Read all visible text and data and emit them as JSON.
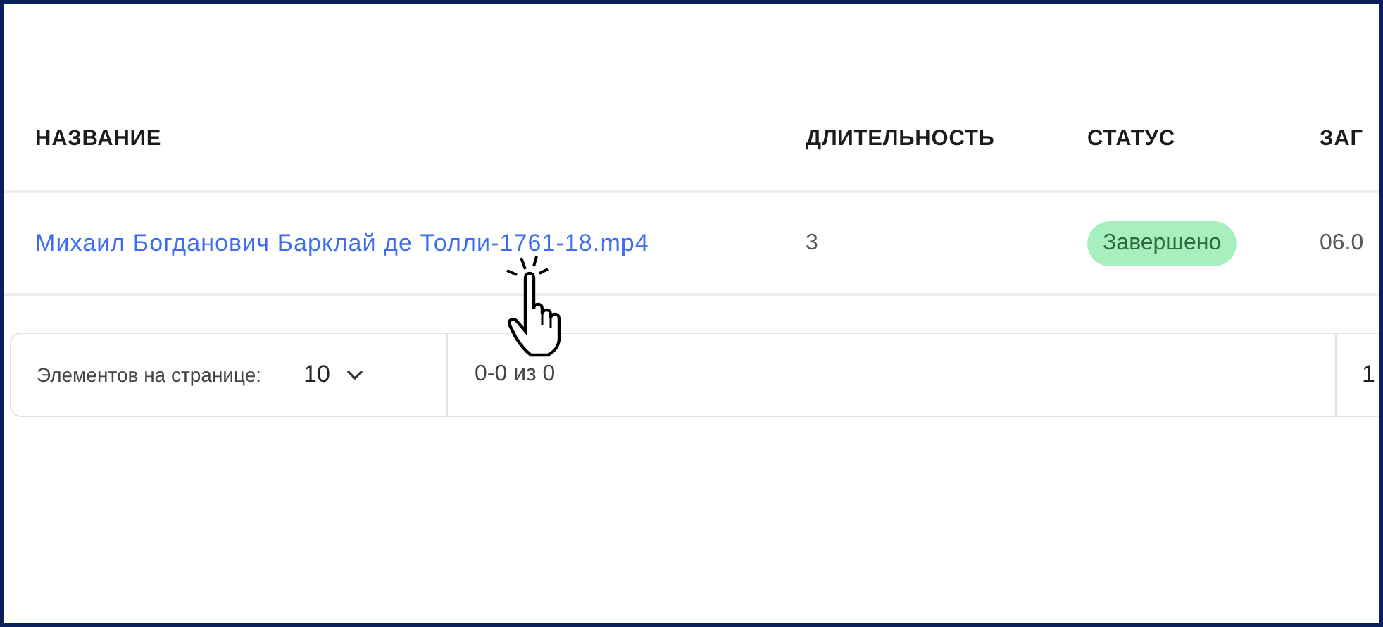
{
  "table": {
    "columns": [
      "НАЗВАНИЕ",
      "ДЛИТЕЛЬНОСТЬ",
      "СТАТУС",
      "ЗАГ"
    ],
    "rows": [
      {
        "name": "Михаил Богданович Барклай де Толли-1761-18.mp4",
        "duration": "3",
        "status": {
          "label": "Завершено",
          "color": "#a8efbf"
        },
        "column_4": "06.0"
      }
    ]
  },
  "pagination": {
    "page_size_label": "Элементов на странице:",
    "page_size": "10",
    "range": "0-0 из 0",
    "page": "1"
  }
}
